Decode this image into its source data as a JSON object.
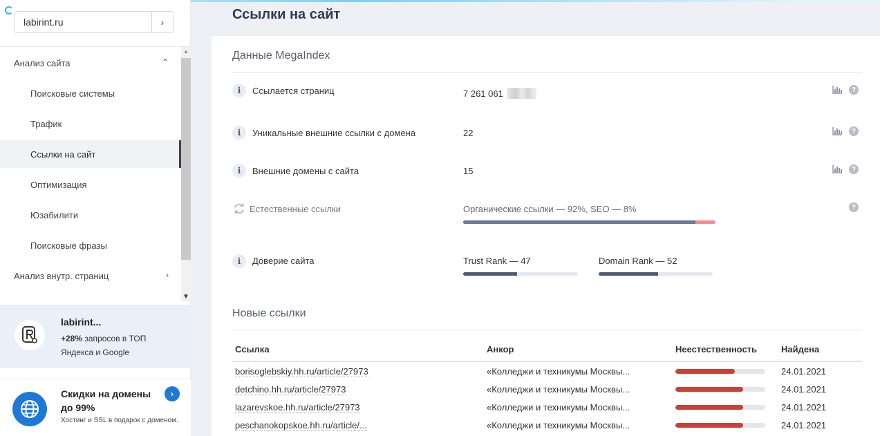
{
  "sidebar": {
    "domain_value": "labirint.ru",
    "go_label": "›",
    "nav": [
      {
        "label": "Анализ сайта",
        "arrow": "⌃"
      },
      {
        "label": "Поисковые системы"
      },
      {
        "label": "Трафик"
      },
      {
        "label": "Ссылки на сайт"
      },
      {
        "label": "Оптимизация"
      },
      {
        "label": "Юзабилити"
      },
      {
        "label": "Поисковые фразы"
      },
      {
        "label": "Анализ внутр. страниц",
        "arrow": "›"
      }
    ],
    "promo1": {
      "title": "labirint...",
      "highlight": "+28%",
      "text": " запросов в ТОП Яндекса и Google"
    },
    "promo2": {
      "title": "Скидки на домены до 99%",
      "text": "Хостинг и SSL в подарок с доменом."
    }
  },
  "page_title": "Ссылки на сайт",
  "megaindex": {
    "title": "Данные MegaIndex",
    "metrics": [
      {
        "label": "Ссылается страниц",
        "value": "7 261 061"
      },
      {
        "label": "Уникальные внешние ссылки с домена",
        "value": "22"
      },
      {
        "label": "Внешние домены с сайта",
        "value": "15"
      }
    ],
    "natural": {
      "label": "Естественные ссылки",
      "summary": "Органические ссылки — 92%, SEO — 8%",
      "organic_percent": 92
    },
    "trust": {
      "label": "Доверие сайта",
      "trust_rank_label": "Trust Rank — 47",
      "trust_rank": 47,
      "domain_rank_label": "Domain Rank — 52",
      "domain_rank": 52
    }
  },
  "new_links": {
    "title": "Новые ссылки",
    "headers": [
      "Ссылка",
      "Анкор",
      "Неестественность",
      "Найдена"
    ],
    "rows": [
      {
        "link": "borisoglebskiy.hh.ru/article/27973",
        "anchor": "«Колледжи и техникумы Москвы...",
        "unnatural": 0.66,
        "date": "24.01.2021"
      },
      {
        "link": "detchino.hh.ru/article/27973",
        "anchor": "«Колледжи и техникумы Москвы...",
        "unnatural": 0.75,
        "date": "24.01.2021"
      },
      {
        "link": "lazarevskoe.hh.ru/article/27973",
        "anchor": "«Колледжи и техникумы Москвы...",
        "unnatural": 0.75,
        "date": "24.01.2021"
      },
      {
        "link": "peschanokopskoe.hh.ru/article/...",
        "anchor": "«Колледжи и техникумы Москвы...",
        "unnatural": 0.75,
        "date": "24.01.2021"
      }
    ]
  },
  "colors": {
    "accent": "#1e79d6",
    "bar_unnatural": "#c8423a",
    "bar_rank": "#4a5a75"
  }
}
